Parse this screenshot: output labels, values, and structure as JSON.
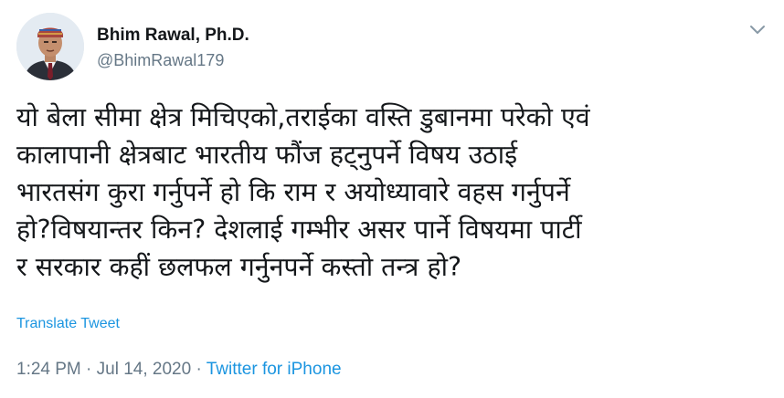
{
  "author": {
    "name": "Bhim Rawal, Ph.D.",
    "handle": "@BhimRawal179"
  },
  "tweet": {
    "lines": [
      "यो बेला सीमा क्षेत्र मिचिएको,तराईका वस्ति डुबानमा परेको एवं",
      "कालापानी क्षेत्रबाट भारतीय फौंज हट्नुपर्ने विषय उठाई",
      "भारतसंग कुरा गर्नुपर्ने हो कि राम र अयोध्यावारे वहस गर्नुपर्ने",
      "हो?विषयान्तर किन? देशलाई गम्भीर असर पार्ने विषयमा पार्टी",
      "र सरकार कहीं छलफल गर्नुनपर्ने कस्तो तन्त्र हो?"
    ],
    "translate_label": "Translate Tweet",
    "time": "1:24 PM",
    "separator": "·",
    "date": "Jul 14, 2020",
    "source": "Twitter for iPhone"
  },
  "colors": {
    "text": "#14171a",
    "secondary": "#657786",
    "link": "#1b95e0"
  },
  "icons": {
    "more": "chevron-down-icon"
  }
}
